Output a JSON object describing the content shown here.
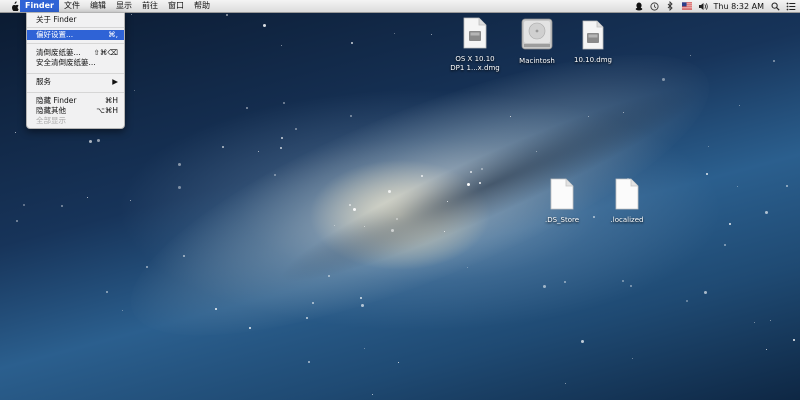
{
  "menubar": {
    "apple_icon": "apple-icon",
    "items": [
      {
        "label": "Finder",
        "active": true
      },
      {
        "label": "文件"
      },
      {
        "label": "编辑"
      },
      {
        "label": "显示"
      },
      {
        "label": "前往"
      },
      {
        "label": "窗口"
      },
      {
        "label": "帮助"
      }
    ],
    "status_icons": [
      "qq-icon",
      "time-machine-icon",
      "bluetooth-icon",
      "us-flag-icon",
      "volume-icon"
    ],
    "clock": "Thu 8:32 AM",
    "right_icons": [
      "spotlight-icon",
      "notification-center-icon"
    ]
  },
  "finder_menu": {
    "about": "关于 Finder",
    "preferences": {
      "label": "偏好设置...",
      "shortcut": "⌘,"
    },
    "empty_trash": {
      "label": "清倒废纸篓...",
      "shortcut": "⇧⌘⌫"
    },
    "secure_empty_trash": "安全清倒废纸篓...",
    "services": "服务",
    "hide_finder": {
      "label": "隐藏 Finder",
      "shortcut": "⌘H"
    },
    "hide_others": {
      "label": "隐藏其他",
      "shortcut": "⌥⌘H"
    },
    "show_all": "全部显示"
  },
  "desktop_icons": {
    "osx_dmg": "OS X 10.10\nDP1 1...x.dmg",
    "macintosh": "Macintosh",
    "dmg_1010": "10.10.dmg",
    "ds_store": ".DS_Store",
    "localized": ".localized"
  },
  "colors": {
    "highlight": "#2f63d6"
  }
}
